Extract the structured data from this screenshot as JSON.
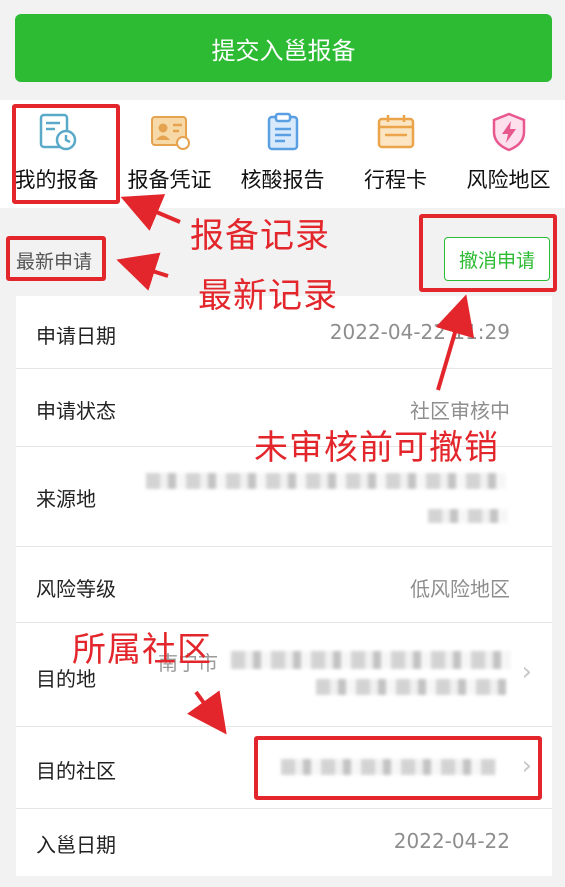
{
  "submit_button": "提交入邕报备",
  "functions": [
    {
      "label": "我的报备",
      "icon": "clock-document-icon"
    },
    {
      "label": "报备凭证",
      "icon": "id-card-icon"
    },
    {
      "label": "核酸报告",
      "icon": "clipboard-icon"
    },
    {
      "label": "行程卡",
      "icon": "calendar-card-icon"
    },
    {
      "label": "风险地区",
      "icon": "shield-lightning-icon"
    }
  ],
  "latest": {
    "label": "最新申请",
    "cancel_button": "撤消申请"
  },
  "details": {
    "apply_date": {
      "label": "申请日期",
      "value": "2022-04-22 11:29"
    },
    "apply_status": {
      "label": "申请状态",
      "value": "社区审核中"
    },
    "origin": {
      "label": "来源地"
    },
    "risk_level": {
      "label": "风险等级",
      "value": "低风险地区"
    },
    "destination": {
      "label": "目的地",
      "value_prefix": "南宁市"
    },
    "destination_community": {
      "label": "目的社区"
    },
    "entry_date": {
      "label": "入邕日期",
      "value": "2022-04-22"
    }
  },
  "annotations": {
    "record": "报备记录",
    "latest_record": "最新记录",
    "cancel_hint": "未审核前可撤销",
    "community": "所属社区"
  },
  "colors": {
    "accent_green": "#2ebb34",
    "annotation_red": "#e3262b"
  }
}
